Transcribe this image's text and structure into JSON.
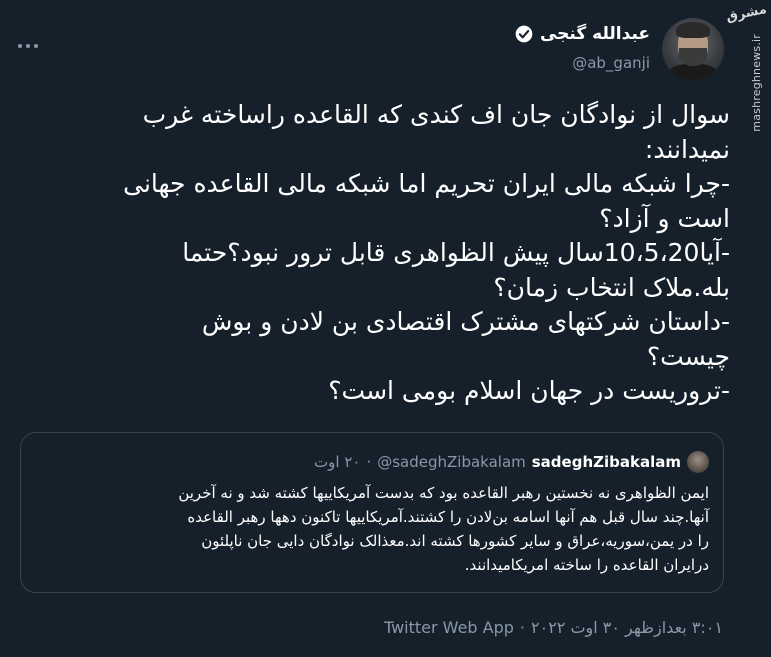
{
  "watermark": {
    "logo": "مشرق",
    "site": "mashreghnews.ir"
  },
  "author": {
    "display_name": "عبدالله گنجی",
    "handle": "@ab_ganji",
    "verified": true
  },
  "tweet": {
    "lines": [
      "سوال از نوادگان جان اف کندی که القاعده راساخته غرب",
      "نمیدانند:",
      "-چرا شبکه مالی ایران تحریم اما شبکه مالی القاعده جهانی",
      "است و آزاد؟",
      "-آیا10،5،20سال پیش الظواهری قابل ترور نبود؟حتما",
      "بله.ملاک انتخاب زمان؟",
      "-داستان شرکتهای مشترک اقتصادی بن لادن و بوش",
      "چیست؟",
      "-تروریست در جهان اسلام بومی است؟"
    ]
  },
  "quoted": {
    "name": "sadeghZibakalam",
    "handle": "@sadeghZibakalam",
    "separator": "·",
    "date": "۲۰ اوت",
    "lines": [
      "ایمن الظواهری نه نخستین رهبر القاعده بود که بدست آمریکاییها کشته شد و نه آخرین",
      "آنها.چند سال قبل هم آنها اسامه بن‌لادن را کشتند.آمریکاییها تاکنون دهها رهبر القاعده",
      "را در یمن،سوریه،عراق و سایر کشورها کشته اند.معذالک نوادگان دایی جان ناپلئون",
      "درایران القاعده را ساخته امریکامیدانند."
    ]
  },
  "footer": {
    "timestamp": "۳:۰۱ بعدازظهر ۳۰ اوت ۲۰۲۲",
    "separator": "·",
    "source": "Twitter Web App"
  },
  "colors": {
    "background": "#15202b",
    "text": "#ffffff",
    "muted": "#8899a6",
    "border": "#38444d",
    "accent": "#1d9bf0"
  }
}
